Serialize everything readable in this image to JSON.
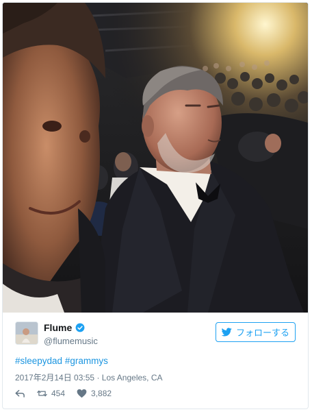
{
  "tweet": {
    "author": {
      "display_name": "Flume",
      "screen_name": "@flumemusic",
      "verified": true
    },
    "follow_button_label": "フォローする",
    "hashtags": [
      "#sleepydad",
      "#grammys"
    ],
    "timestamp": "2017年2月14日 03:55",
    "location_separator": "·",
    "location": "Los Angeles, CA",
    "retweet_count": "454",
    "like_count": "3,882"
  },
  "colors": {
    "accent": "#1da1f2",
    "hashtag": "#1b95e0",
    "muted": "#657786",
    "border": "#e1e8ed"
  },
  "icons": {
    "verified": "verified-badge-icon",
    "follow": "twitter-bird-icon",
    "reply": "reply-icon",
    "retweet": "retweet-icon",
    "like": "heart-icon"
  }
}
